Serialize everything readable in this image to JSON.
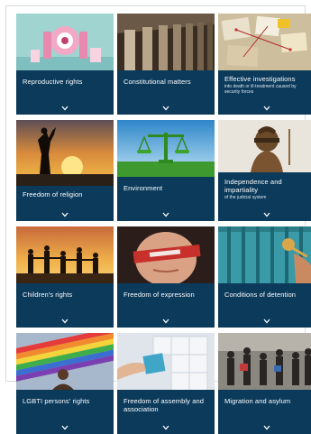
{
  "cards": [
    {
      "title": "Reproductive rights",
      "subtitle": "",
      "image": "reproductive-rights-image",
      "icon": "chevron-down-icon"
    },
    {
      "title": "Constitutional matters",
      "subtitle": "",
      "image": "columns-image",
      "icon": "chevron-down-icon"
    },
    {
      "title": "Effective investigations",
      "subtitle": "into death or ill-treatment caused by security forces",
      "image": "evidence-board-image",
      "icon": "chevron-down-icon"
    },
    {
      "title": "Freedom of religion",
      "subtitle": "",
      "image": "sunset-silhouette-image",
      "icon": "chevron-down-icon"
    },
    {
      "title": "Environment",
      "subtitle": "",
      "image": "green-scales-image",
      "icon": "chevron-down-icon"
    },
    {
      "title": "Independence and impartiality",
      "subtitle": "of the judicial system",
      "image": "lady-justice-image",
      "icon": "chevron-down-icon"
    },
    {
      "title": "Children's rights",
      "subtitle": "",
      "image": "children-silhouette-image",
      "icon": "chevron-down-icon"
    },
    {
      "title": "Freedom of expression",
      "subtitle": "",
      "image": "gagged-mouth-image",
      "icon": "chevron-down-icon"
    },
    {
      "title": "Conditions of detention",
      "subtitle": "",
      "image": "prison-bars-image",
      "icon": "chevron-down-icon"
    },
    {
      "title": "LGBTI persons' rights",
      "subtitle": "",
      "image": "rainbow-flag-image",
      "icon": "chevron-down-icon"
    },
    {
      "title": "Freedom of assembly and association",
      "subtitle": "",
      "image": "puzzle-image",
      "icon": "chevron-down-icon"
    },
    {
      "title": "Migration and asylum",
      "subtitle": "",
      "image": "migrants-crowd-image",
      "icon": "chevron-down-icon"
    }
  ]
}
